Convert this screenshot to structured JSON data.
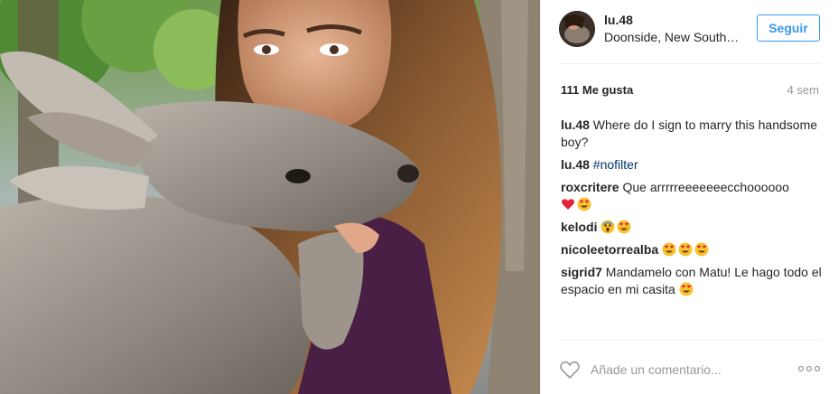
{
  "post": {
    "username": "lu.48",
    "location": "Doonside, New South Wales",
    "follow_label": "Seguir",
    "likes": "111 Me gusta",
    "time_ago": "4 sem"
  },
  "comments": [
    {
      "user": "lu.48",
      "text": "Where do I sign to marry this handsome boy?"
    },
    {
      "user": "lu.48",
      "text": "",
      "hashtag": "#nofilter"
    },
    {
      "user": "roxcritere",
      "text": "Que arrrrreeeeeeecchoooooo",
      "emojis": [
        "red-heart",
        "heart-eyes"
      ]
    },
    {
      "user": "kelodi",
      "text": "",
      "emojis": [
        "screaming-face",
        "heart-eyes"
      ]
    },
    {
      "user": "nicoleetorrealba",
      "text": "",
      "emojis": [
        "heart-eyes",
        "heart-eyes",
        "heart-eyes"
      ]
    },
    {
      "user": "sigrid7",
      "text": "Mandamelo con Matu! Le hago todo el espacio en mi casita",
      "emojis": [
        "heart-eyes"
      ]
    }
  ],
  "footer": {
    "comment_placeholder": "Añade un comentario...",
    "like_icon": "heart-outline-icon",
    "more_icon": "more-options-icon"
  },
  "colors": {
    "accent": "#3897f0",
    "text": "#262626",
    "muted": "#999999",
    "hashtag": "#003569",
    "divider": "#efefef"
  }
}
